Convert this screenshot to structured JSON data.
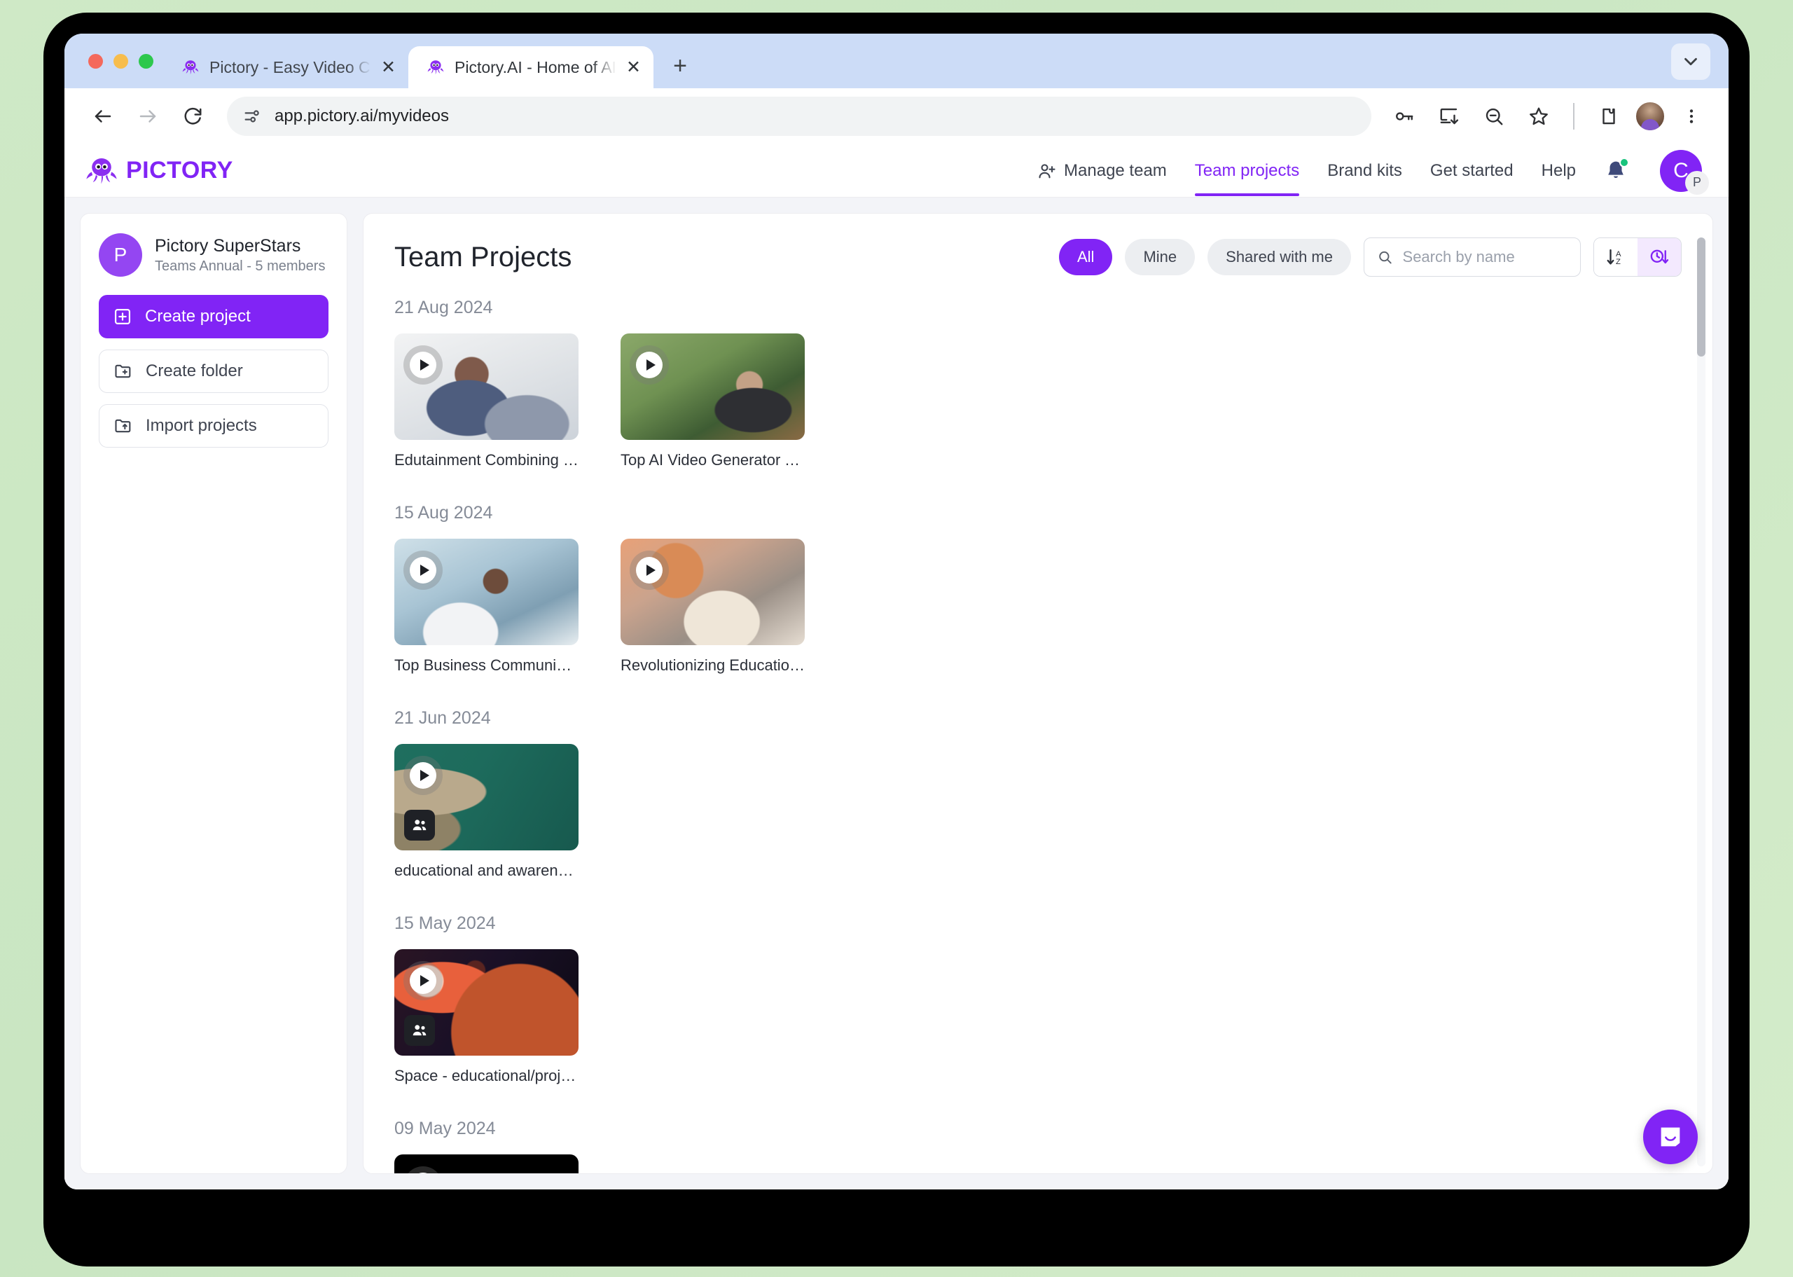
{
  "browser": {
    "tabs": [
      {
        "title": "Pictory - Easy Video Creation",
        "favicon": "octopus-icon",
        "active": false,
        "close": "✕"
      },
      {
        "title": "Pictory.AI - Home of AI Video",
        "favicon": "octopus-icon",
        "active": true,
        "close": "✕"
      }
    ],
    "new_tab_label": "+",
    "url": "app.pictory.ai/myvideos",
    "toolbar_icons": [
      "back-icon",
      "forward-icon",
      "reload-icon",
      "site-settings-icon",
      "password-key-icon",
      "install-app-icon",
      "zoom-out-icon",
      "bookmark-star-icon",
      "extensions-icon",
      "profile-avatar-icon",
      "chrome-menu-icon"
    ],
    "tab_list_label": "⌄"
  },
  "app": {
    "logo_text": "PICTORY",
    "brand_color": "#8124f5",
    "nav": [
      {
        "label": "Manage team",
        "icon": "add-person-icon",
        "active": false
      },
      {
        "label": "Team projects",
        "icon": "",
        "active": true
      },
      {
        "label": "Brand kits",
        "icon": "",
        "active": false
      },
      {
        "label": "Get started",
        "icon": "",
        "active": false
      },
      {
        "label": "Help",
        "icon": "",
        "active": false
      }
    ],
    "notification_icon": "bell-icon",
    "notification_has_badge": true,
    "user_initial": "C",
    "user_team_badge": "P"
  },
  "sidebar": {
    "team_initial": "P",
    "team_name": "Pictory SuperStars",
    "team_plan": "Teams Annual - 5 members",
    "buttons": [
      {
        "label": "Create project",
        "icon": "plus-square-icon",
        "style": "primary"
      },
      {
        "label": "Create folder",
        "icon": "folder-plus-icon",
        "style": "ghost"
      },
      {
        "label": "Import projects",
        "icon": "folder-upload-icon",
        "style": "ghost"
      }
    ]
  },
  "main": {
    "title": "Team Projects",
    "filters": [
      {
        "label": "All",
        "active": true
      },
      {
        "label": "Mine",
        "active": false
      },
      {
        "label": "Shared with me",
        "active": false
      }
    ],
    "search": {
      "placeholder": "Search by name",
      "value": "",
      "icon": "search-icon"
    },
    "sort": [
      {
        "name": "sort-alphabetical",
        "label": "A↓Z",
        "active": false
      },
      {
        "name": "sort-recent",
        "label": "clock",
        "active": true
      }
    ],
    "groups": [
      {
        "date": "21 Aug 2024",
        "projects": [
          {
            "title": "Edutainment Combining Fun ...",
            "thumb": "th-edu",
            "shared": false
          },
          {
            "title": "Top AI Video Generator Tool...",
            "thumb": "th-gen",
            "shared": false
          }
        ]
      },
      {
        "date": "15 Aug 2024",
        "projects": [
          {
            "title": "Top Business Communicatio...",
            "thumb": "th-bus",
            "shared": false
          },
          {
            "title": "Revolutionizing Education fo...",
            "thumb": "th-rev",
            "shared": false
          }
        ]
      },
      {
        "date": "21 Jun 2024",
        "projects": [
          {
            "title": "educational and awareness",
            "thumb": "th-ocean",
            "shared": true
          }
        ]
      },
      {
        "date": "15 May 2024",
        "projects": [
          {
            "title": "Space - educational/project/...",
            "thumb": "th-space",
            "shared": true
          }
        ]
      },
      {
        "date": "09 May 2024",
        "projects": [
          {
            "title": "",
            "thumb": "th-black",
            "shared": false
          }
        ]
      }
    ]
  },
  "chat_widget": {
    "icon": "intercom-chat-icon"
  }
}
